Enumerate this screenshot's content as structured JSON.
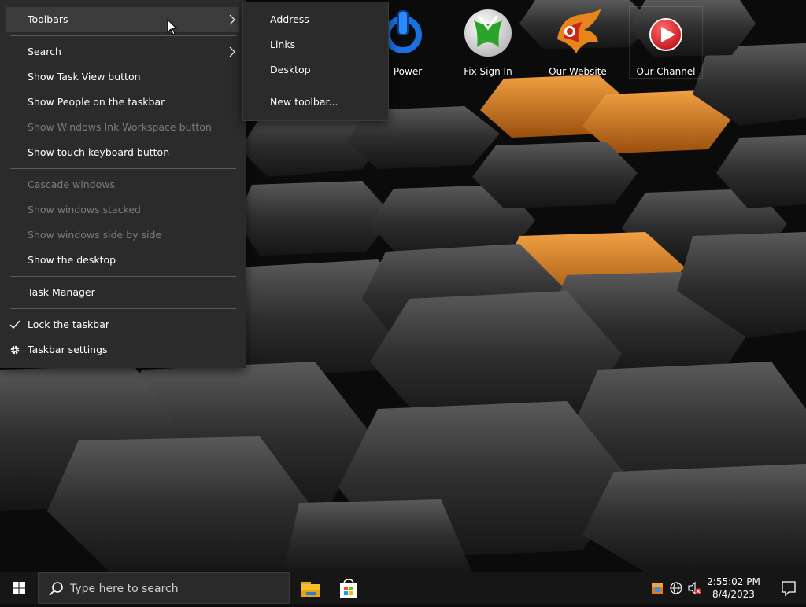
{
  "desktop_icons": [
    {
      "label": "Power",
      "icon": "power-icon"
    },
    {
      "label": "Fix Sign In",
      "icon": "xbox-icon"
    },
    {
      "label": "Our Website",
      "icon": "phoenix-logo-icon"
    },
    {
      "label": "Our Channel",
      "icon": "play-button-icon"
    }
  ],
  "context_menu": {
    "items": [
      {
        "label": "Toolbars",
        "has_submenu": true,
        "highlighted": true
      },
      {
        "label": "Search",
        "has_submenu": true
      },
      {
        "label": "Show Task View button"
      },
      {
        "label": "Show People on the taskbar"
      },
      {
        "label": "Show Windows Ink Workspace button",
        "disabled": true
      },
      {
        "label": "Show touch keyboard button"
      },
      {
        "label": "Cascade windows",
        "disabled": true
      },
      {
        "label": "Show windows stacked",
        "disabled": true
      },
      {
        "label": "Show windows side by side",
        "disabled": true
      },
      {
        "label": "Show the desktop"
      },
      {
        "label": "Task Manager"
      },
      {
        "label": "Lock the taskbar",
        "checked": true
      },
      {
        "label": "Taskbar settings",
        "icon": "gear-icon"
      }
    ]
  },
  "toolbars_submenu": {
    "items": [
      {
        "label": "Address"
      },
      {
        "label": "Links"
      },
      {
        "label": "Desktop"
      },
      {
        "label": "New toolbar..."
      }
    ]
  },
  "taskbar": {
    "search_placeholder": "Type here to search",
    "apps": [
      {
        "name": "File Explorer",
        "icon": "folder-icon"
      },
      {
        "name": "Microsoft Store",
        "icon": "store-icon"
      }
    ],
    "tray_icons": [
      "store-bag-icon",
      "globe-network-icon",
      "speaker-muted-icon"
    ],
    "clock": {
      "time": "2:55:02 PM",
      "date": "8/4/2023"
    }
  },
  "colors": {
    "menu_bg": "#2b2b2b",
    "menu_highlight": "#3b3b3b",
    "disabled_text": "#7c7c7c",
    "taskbar_bg": "#161616",
    "accent_orange": "#e58a1f"
  }
}
